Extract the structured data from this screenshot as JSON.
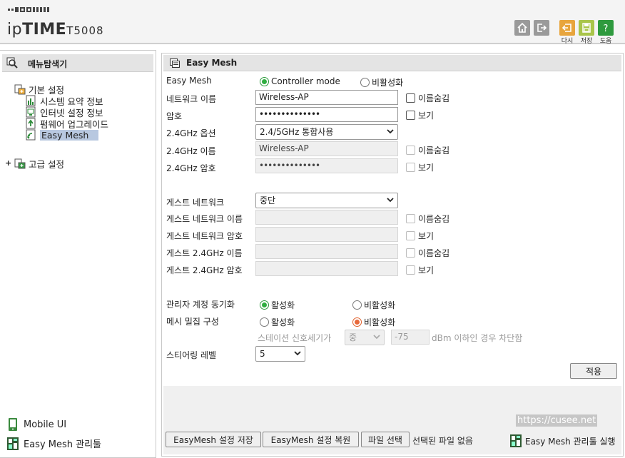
{
  "header": {
    "logo_text_a": "ip",
    "logo_text_b": "TIME",
    "model": "T5008",
    "buttons": [
      {
        "icon": "home-icon",
        "label": ""
      },
      {
        "icon": "logout-icon",
        "label": ""
      },
      {
        "icon": "back-icon",
        "label": "다시"
      },
      {
        "icon": "save-icon",
        "label": "저장"
      },
      {
        "icon": "help-icon",
        "label": "도움"
      }
    ],
    "colors": {
      "back": "#e8a53c",
      "save": "#a9c54a",
      "help": "#2e9a3e",
      "gray": "#9a9a9a"
    }
  },
  "sidebar": {
    "title": "메뉴탐색기",
    "basic": {
      "label": "기본 설정",
      "items": [
        {
          "label": "시스템 요약 정보"
        },
        {
          "label": "인터넷 설정 정보"
        },
        {
          "label": "펌웨어 업그레이드"
        },
        {
          "label": "Easy Mesh"
        }
      ]
    },
    "advanced": {
      "expander": "+",
      "label": "고급 설정"
    },
    "bottom": {
      "mobile": "Mobile UI",
      "mesh_tool": "Easy Mesh 관리툴"
    }
  },
  "main": {
    "title": "Easy Mesh",
    "easymesh": {
      "label": "Easy Mesh",
      "opt1": "Controller mode",
      "opt2": "비활성화",
      "selected": "Controller mode"
    },
    "network_name": {
      "label": "네트워크 이름",
      "value": "Wireless-AP",
      "hide_label": "이름숨김"
    },
    "password": {
      "label": "암호",
      "value": "••••••••••••••",
      "show_label": "보기"
    },
    "band": {
      "label": "2.4GHz 옵션",
      "value": "2.4/5GHz 통합사용"
    },
    "name24": {
      "label": "2.4GHz 이름",
      "value": "Wireless-AP",
      "hide_label": "이름숨김"
    },
    "pw24": {
      "label": "2.4GHz 암호",
      "value": "••••••••••••••",
      "show_label": "보기"
    },
    "guest": {
      "label": "게스트 네트워크",
      "value": "중단"
    },
    "guest_name": {
      "label": "게스트 네트워크 이름",
      "value": "",
      "hide_label": "이름숨김"
    },
    "guest_pw": {
      "label": "게스트 네트워크 암호",
      "value": "",
      "show_label": "보기"
    },
    "guest_name24": {
      "label": "게스트 2.4GHz 이름",
      "value": "",
      "hide_label": "이름숨김"
    },
    "guest_pw24": {
      "label": "게스트 2.4GHz 암호",
      "value": "",
      "show_label": "보기"
    },
    "admin_sync": {
      "label": "관리자 계정 동기화",
      "on": "활성화",
      "off": "비활성화",
      "selected": "활성화"
    },
    "mesh_density": {
      "label": "메시 밀집 구성",
      "on": "활성화",
      "off": "비활성화",
      "selected": "비활성화"
    },
    "signal": {
      "label": "스테이션 신호세기가",
      "level": "중",
      "dbm": "-75",
      "suffix": "dBm 이하인 경우 차단함"
    },
    "steering": {
      "label": "스티어링 레벨",
      "value": "5"
    },
    "apply": "적용",
    "footer": {
      "save_cfg": "EasyMesh 설정 저장",
      "restore_cfg": "EasyMesh 설정 복원",
      "file_select": "파일 선택",
      "no_file": "선택된 파일 없음",
      "watermark": "https://cusee.net",
      "run_tool": "Easy Mesh 관리툴 실행"
    }
  }
}
